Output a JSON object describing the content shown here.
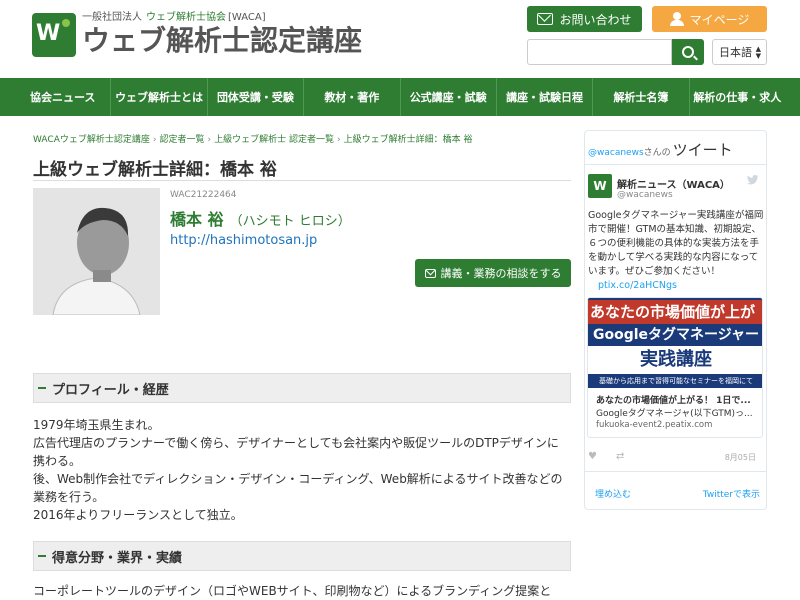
{
  "header": {
    "logo_org": "一般社団法人",
    "logo_assoc": "ウェブ解析士協会",
    "logo_tag": "[WACA]",
    "logo_main": "ウェブ解析士認定講座",
    "contact_label": "お問い合わせ",
    "mypage_label": "マイページ",
    "search_value": "",
    "language": "日本語",
    "colors": {
      "primary": "#2e7d32",
      "mypage": "#f5a742"
    }
  },
  "nav": {
    "items": [
      "協会ニュース",
      "ウェブ解析士とは",
      "団体受講・受験",
      "教材・著作",
      "公式講座・試験",
      "講座・試験日程",
      "解析士名簿",
      "解析の仕事・求人"
    ]
  },
  "breadcrumb": [
    "WACAウェブ解析士認定講座",
    "認定者一覧",
    "上級ウェブ解析士 認定者一覧",
    "上級ウェブ解析士詳細：橋本 裕"
  ],
  "page": {
    "title": "上級ウェブ解析士詳細：橋本 裕",
    "member_id": "WAC21222464",
    "name": "橋本 裕",
    "kana": "（ハシモト ヒロシ）",
    "url": "http://hashimotosan.jp",
    "consult_label": "講義・業務の相談をする"
  },
  "sections": {
    "profile_heading": "プロフィール・経歴",
    "profile_lines": [
      "1979年埼玉県生まれ。",
      "広告代理店のプランナーで働く傍ら、デザイナーとしても会社案内や販促ツールのDTPデザインに",
      "携わる。",
      "後、Web制作会社でディレクション・デザイン・コーディング、Web解析によるサイト改善などの",
      "業務を行う。",
      "2016年よりフリーランスとして独立。"
    ],
    "skills_heading": "得意分野・業界・実績",
    "skills_text": "コーポレートツールのデザイン（ロゴやWEBサイト、印刷物など）によるブランディング提案と"
  },
  "twitter": {
    "account": "@wacanews",
    "of": "さんの",
    "tweets_label": "ツイート",
    "user_name": "解析ニュース（WACA）",
    "handle": "@wacanews",
    "body": "Googleタグマネージャー実践講座が福岡市で開催！GTMの基本知識、初期設定、６つの便利機能の具体的な実装方法を手を動かして学べる実践的な内容になっています。ぜひご参加ください！",
    "link": "ptix.co/2aHCNgs",
    "card_img_line1": "あなたの市場価値が上が",
    "card_img_line2": "Googleタグマネージャー",
    "card_img_line3": "実践講座",
    "card_img_line4": "基礎から応用まで習得可能なセミナーを福岡にて",
    "card_title": "あなたの市場価値が上がる！ 1日で...",
    "card_desc": "Googleタグマネージャ(以下GTM)っ...",
    "card_url": "fukuoka-event2.peatix.com",
    "date": "8月05日",
    "embed_label": "埋め込む",
    "view_label": "Twitterで表示"
  }
}
